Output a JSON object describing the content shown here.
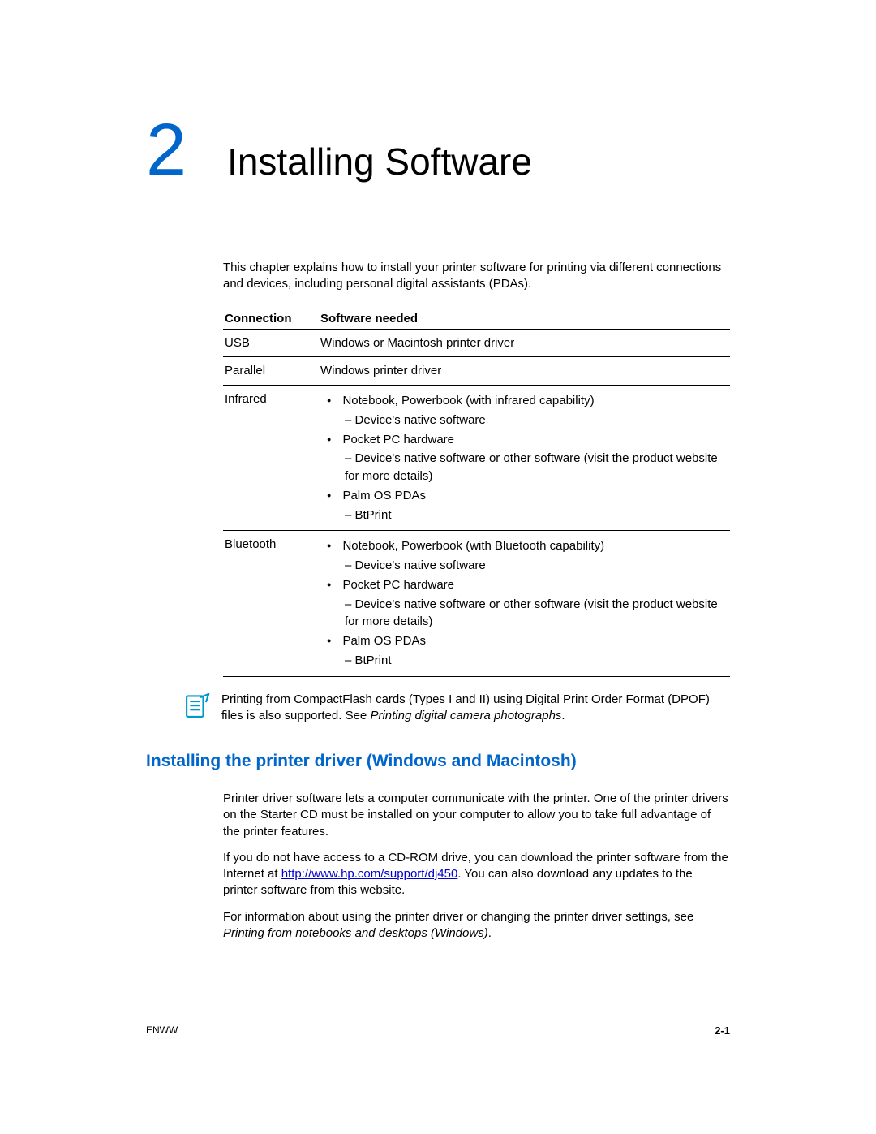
{
  "chapter": {
    "number": "2",
    "title": "Installing Software"
  },
  "intro": "This chapter explains how to install your printer software for printing via different connections and devices, including personal digital assistants (PDAs).",
  "table": {
    "headers": {
      "col1": "Connection",
      "col2": "Software needed"
    },
    "rows": {
      "usb": {
        "c1": "USB",
        "c2": "Windows or Macintosh printer driver"
      },
      "parallel": {
        "c1": "Parallel",
        "c2": "Windows printer driver"
      },
      "infrared": {
        "c1": "Infrared",
        "i1": "Notebook, Powerbook (with infrared capability)",
        "i1s": "– Device's native software",
        "i2": "Pocket PC hardware",
        "i2s": "– Device's native software or other software (visit the product website for more details)",
        "i3": "Palm OS PDAs",
        "i3s": "– BtPrint"
      },
      "bluetooth": {
        "c1": "Bluetooth",
        "i1": "Notebook, Powerbook (with Bluetooth capability)",
        "i1s": "– Device's native software",
        "i2": "Pocket PC hardware",
        "i2s": "– Device's native software or other software (visit the product website for more details)",
        "i3": "Palm OS PDAs",
        "i3s": "– BtPrint"
      }
    }
  },
  "note": {
    "part1": "Printing from CompactFlash cards (Types I and II) using Digital Print Order Format (DPOF) files is also supported. See ",
    "ital": "Printing digital camera photographs",
    "part2": "."
  },
  "section_heading": "Installing the printer driver (Windows and Macintosh)",
  "p1": "Printer driver software lets a computer communicate with the printer. One of the printer drivers on the Starter CD must be installed on your computer to allow you to take full advantage of the printer features.",
  "p2a": "If you do not have access to a CD-ROM drive, you can download the printer software from the Internet at ",
  "p2link": "http://www.hp.com/support/dj450",
  "p2b": ". You can also download any updates to the printer software from this website.",
  "p3a": "For information about using the printer driver or changing the printer driver settings, see ",
  "p3ital": "Printing from notebooks and desktops (Windows)",
  "p3b": ".",
  "footer": {
    "left": "ENWW",
    "right": "2-1"
  }
}
